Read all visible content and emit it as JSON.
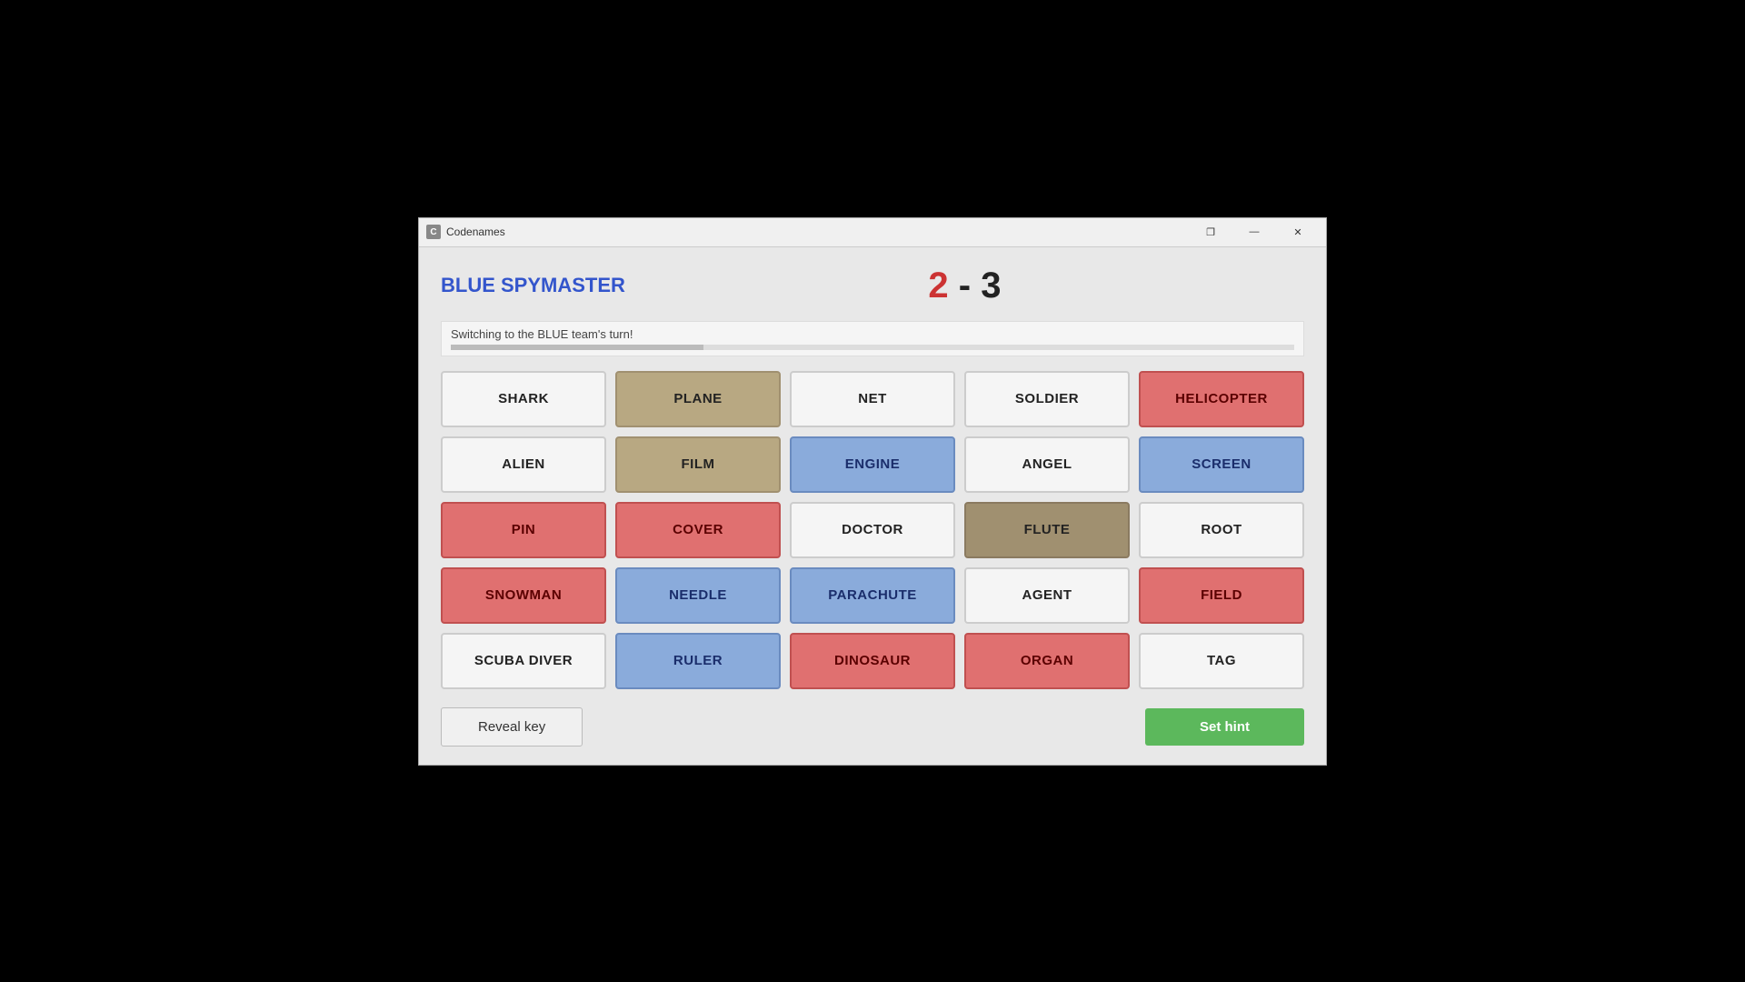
{
  "window": {
    "title": "Codenames",
    "icon_label": "C"
  },
  "header": {
    "role_label": "BLUE SPYMASTER",
    "score_red": "2",
    "score_separator": " - ",
    "score_blue": "3"
  },
  "status": {
    "message": "Switching to the BLUE team's turn!"
  },
  "grid": [
    {
      "word": "SHARK",
      "type": "neutral"
    },
    {
      "word": "PLANE",
      "type": "tan"
    },
    {
      "word": "NET",
      "type": "neutral"
    },
    {
      "word": "SOLDIER",
      "type": "neutral"
    },
    {
      "word": "HELICOPTER",
      "type": "red"
    },
    {
      "word": "ALIEN",
      "type": "neutral"
    },
    {
      "word": "FILM",
      "type": "tan"
    },
    {
      "word": "ENGINE",
      "type": "blue"
    },
    {
      "word": "ANGEL",
      "type": "neutral"
    },
    {
      "word": "SCREEN",
      "type": "blue"
    },
    {
      "word": "PIN",
      "type": "red"
    },
    {
      "word": "COVER",
      "type": "red"
    },
    {
      "word": "DOCTOR",
      "type": "neutral"
    },
    {
      "word": "FLUTE",
      "type": "dark-tan"
    },
    {
      "word": "ROOT",
      "type": "neutral"
    },
    {
      "word": "SNOWMAN",
      "type": "red"
    },
    {
      "word": "NEEDLE",
      "type": "blue"
    },
    {
      "word": "PARACHUTE",
      "type": "blue"
    },
    {
      "word": "AGENT",
      "type": "neutral"
    },
    {
      "word": "FIELD",
      "type": "red"
    },
    {
      "word": "SCUBA DIVER",
      "type": "neutral"
    },
    {
      "word": "RULER",
      "type": "blue"
    },
    {
      "word": "DINOSAUR",
      "type": "red"
    },
    {
      "word": "ORGAN",
      "type": "red"
    },
    {
      "word": "TAG",
      "type": "neutral"
    }
  ],
  "buttons": {
    "reveal_key": "Reveal key",
    "set_hint": "Set hint"
  },
  "titlebar": {
    "minimize": "—",
    "restore": "❐",
    "close": "✕"
  }
}
